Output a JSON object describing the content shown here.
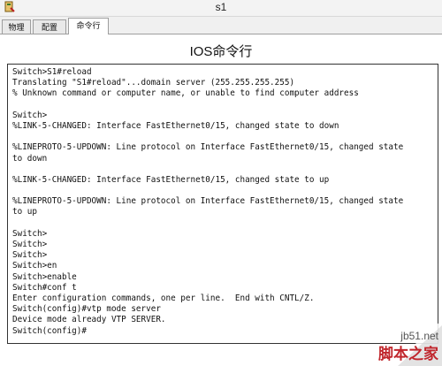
{
  "window": {
    "title": "s1"
  },
  "tabs": [
    {
      "label": "物理"
    },
    {
      "label": "配置"
    },
    {
      "label": "命令行"
    }
  ],
  "panel": {
    "title": "IOS命令行"
  },
  "console": {
    "lines": [
      "Switch>S1#reload",
      "Translating \"S1#reload\"...domain server (255.255.255.255)",
      "% Unknown command or computer name, or unable to find computer address",
      "",
      "Switch>",
      "%LINK-5-CHANGED: Interface FastEthernet0/15, changed state to down",
      "",
      "%LINEPROTO-5-UPDOWN: Line protocol on Interface FastEthernet0/15, changed state",
      "to down",
      "",
      "%LINK-5-CHANGED: Interface FastEthernet0/15, changed state to up",
      "",
      "%LINEPROTO-5-UPDOWN: Line protocol on Interface FastEthernet0/15, changed state",
      "to up",
      "",
      "Switch>",
      "Switch>",
      "Switch>",
      "Switch>en",
      "Switch>enable",
      "Switch#conf t",
      "Enter configuration commands, one per line.  End with CNTL/Z.",
      "Switch(config)#vtp mode server",
      "Device mode already VTP SERVER.",
      "Switch(config)#"
    ]
  },
  "watermark": {
    "site": "jb51.net",
    "name": "脚本之家"
  }
}
